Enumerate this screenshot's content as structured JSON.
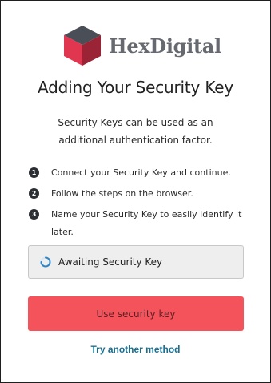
{
  "brand": {
    "name": "HexDigital",
    "logo_icon": "hexagon-cube-logo",
    "colors": {
      "logo_top": "#4a4e56",
      "logo_left": "#e0364f",
      "logo_right": "#9a2336",
      "text": "#666a70"
    }
  },
  "page": {
    "title": "Adding Your Security Key",
    "subtitle": "Security Keys can be used as an additional authentication factor."
  },
  "steps": [
    {
      "number": "1",
      "text": "Connect your Security Key and continue."
    },
    {
      "number": "2",
      "text": "Follow the steps on the browser."
    },
    {
      "number": "3",
      "text": "Name your Security Key to easily identify it later."
    }
  ],
  "status": {
    "text": "Awaiting Security Key",
    "icon": "loading-spinner-icon"
  },
  "actions": {
    "primary_label": "Use security key",
    "alternate_label": "Try another method"
  },
  "colors": {
    "primary_button": "#f4535b",
    "link": "#1a6f90",
    "spinner": "#2f86c6",
    "step_badge": "#2b2e33"
  }
}
